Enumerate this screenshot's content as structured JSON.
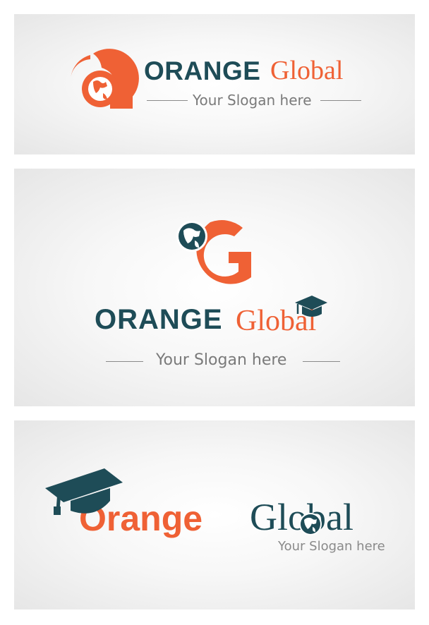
{
  "colors": {
    "orange": "#ef6135",
    "teal": "#1e4c57",
    "slogan": "#7a7a7a"
  },
  "logo1": {
    "word1": "ORANGE",
    "word2": "Global",
    "slogan": "Your Slogan here",
    "icon": "g-globe-icon"
  },
  "logo2": {
    "word1": "ORANGE",
    "word2": "Global",
    "slogan": "Your Slogan here",
    "icon": "g-globe-icon",
    "cap_icon": "graduation-cap-icon"
  },
  "logo3": {
    "word1": "Orange",
    "word2": "Global",
    "slogan": "Your Slogan here",
    "cap_icon": "graduation-cap-icon",
    "globe_icon": "globe-icon"
  }
}
